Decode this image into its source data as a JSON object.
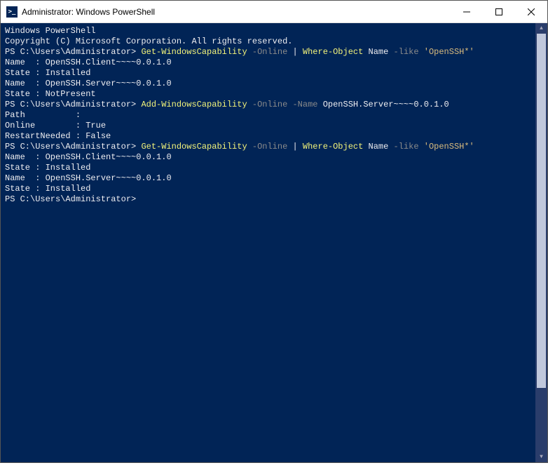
{
  "titlebar": {
    "icon_text": ">_",
    "title": "Administrator: Windows PowerShell"
  },
  "terminal": {
    "header_line1": "Windows PowerShell",
    "header_line2": "Copyright (C) Microsoft Corporation. All rights reserved.",
    "prompt": "PS C:\\Users\\Administrator>",
    "entries": [
      {
        "command_parts": {
          "cmd1": "Get-WindowsCapability",
          "param1": "-Online",
          "pipe": "|",
          "cmd2": "Where-Object",
          "arg1": "Name",
          "param2": "-like",
          "str": "'OpenSSH*'"
        },
        "output_lines": [
          "",
          "",
          "Name  : OpenSSH.Client~~~~0.0.1.0",
          "State : Installed",
          "",
          "Name  : OpenSSH.Server~~~~0.0.1.0",
          "State : NotPresent",
          "",
          ""
        ]
      },
      {
        "command_parts": {
          "cmd1": "Add-WindowsCapability",
          "param1": "-Online",
          "param2": "-Name",
          "arg_plain": "OpenSSH.Server~~~~0.0.1.0"
        },
        "output_lines": [
          "",
          "",
          "Path          :",
          "Online        : True",
          "RestartNeeded : False",
          "",
          ""
        ]
      },
      {
        "command_parts": {
          "cmd1": "Get-WindowsCapability",
          "param1": "-Online",
          "pipe": "|",
          "cmd2": "Where-Object",
          "arg1": "Name",
          "param2": "-like",
          "str": "'OpenSSH*'"
        },
        "output_lines": [
          "",
          "",
          "Name  : OpenSSH.Client~~~~0.0.1.0",
          "State : Installed",
          "",
          "Name  : OpenSSH.Server~~~~0.0.1.0",
          "State : Installed",
          "",
          ""
        ]
      }
    ],
    "final_prompt": "PS C:\\Users\\Administrator>"
  }
}
